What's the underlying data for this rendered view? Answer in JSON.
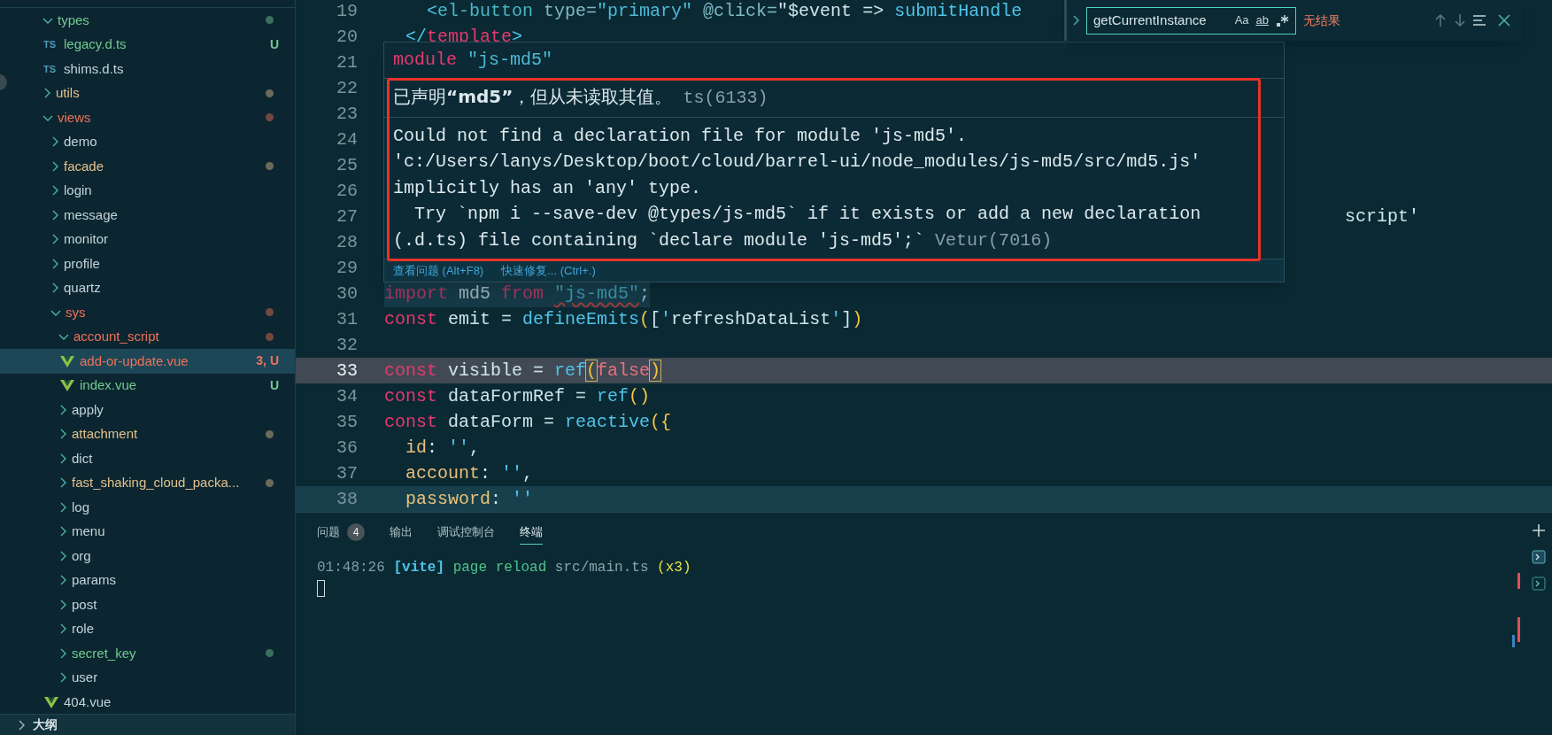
{
  "sidebar": {
    "tree": [
      {
        "label": "types",
        "kind": "folder",
        "expanded": true,
        "color": "#73c991",
        "dot": true,
        "selected": false,
        "children": [
          {
            "label": "legacy.d.ts",
            "kind": "ts_file",
            "icon_text": "TS",
            "color": "#73c991",
            "badge": "U",
            "selected": false
          },
          {
            "label": "shims.d.ts",
            "kind": "ts_file",
            "icon_text": "TS",
            "color": "#c3d3d8",
            "selected": false
          }
        ]
      },
      {
        "label": "utils",
        "kind": "folder",
        "expanded": false,
        "color": "#e2c08d",
        "dot": true,
        "selected": false
      },
      {
        "label": "views",
        "kind": "folder",
        "expanded": true,
        "color": "#f0715a",
        "dot": true,
        "selected": false,
        "children": [
          {
            "label": "demo",
            "kind": "folder",
            "expanded": false,
            "color": "#c3d3d8",
            "dot": false,
            "selected": false
          },
          {
            "label": "facade",
            "kind": "folder",
            "expanded": false,
            "color": "#e2c08d",
            "dot": true,
            "selected": false
          },
          {
            "label": "login",
            "kind": "folder",
            "expanded": false,
            "color": "#c3d3d8",
            "dot": false,
            "selected": false
          },
          {
            "label": "message",
            "kind": "folder",
            "expanded": false,
            "color": "#c3d3d8",
            "dot": false,
            "selected": false
          },
          {
            "label": "monitor",
            "kind": "folder",
            "expanded": false,
            "color": "#c3d3d8",
            "dot": false,
            "selected": false
          },
          {
            "label": "profile",
            "kind": "folder",
            "expanded": false,
            "color": "#c3d3d8",
            "dot": false,
            "selected": false
          },
          {
            "label": "quartz",
            "kind": "folder",
            "expanded": false,
            "color": "#c3d3d8",
            "dot": false,
            "selected": false
          },
          {
            "label": "sys",
            "kind": "folder",
            "expanded": true,
            "color": "#f0715a",
            "dot": true,
            "selected": false,
            "children": [
              {
                "label": "account_script",
                "kind": "folder",
                "expanded": true,
                "color": "#f0715a",
                "dot": true,
                "selected": false,
                "children": [
                  {
                    "label": "add-or-update.vue",
                    "kind": "vue_file",
                    "color": "#f0715a",
                    "badge": "3, U",
                    "selected": true
                  },
                  {
                    "label": "index.vue",
                    "kind": "vue_file",
                    "color": "#73c991",
                    "badge": "U",
                    "selected": false
                  }
                ]
              },
              {
                "label": "apply",
                "kind": "folder",
                "expanded": false,
                "color": "#c3d3d8",
                "dot": false,
                "selected": false
              },
              {
                "label": "attachment",
                "kind": "folder",
                "expanded": false,
                "color": "#e2c08d",
                "dot": true,
                "selected": false
              },
              {
                "label": "dict",
                "kind": "folder",
                "expanded": false,
                "color": "#c3d3d8",
                "dot": false,
                "selected": false
              },
              {
                "label": "fast_shaking_cloud_packa...",
                "kind": "folder",
                "expanded": false,
                "color": "#e2c08d",
                "dot": true,
                "selected": false
              },
              {
                "label": "log",
                "kind": "folder",
                "expanded": false,
                "color": "#c3d3d8",
                "dot": false,
                "selected": false
              },
              {
                "label": "menu",
                "kind": "folder",
                "expanded": false,
                "color": "#c3d3d8",
                "dot": false,
                "selected": false
              },
              {
                "label": "org",
                "kind": "folder",
                "expanded": false,
                "color": "#c3d3d8",
                "dot": false,
                "selected": false
              },
              {
                "label": "params",
                "kind": "folder",
                "expanded": false,
                "color": "#c3d3d8",
                "dot": false,
                "selected": false
              },
              {
                "label": "post",
                "kind": "folder",
                "expanded": false,
                "color": "#c3d3d8",
                "dot": false,
                "selected": false
              },
              {
                "label": "role",
                "kind": "folder",
                "expanded": false,
                "color": "#c3d3d8",
                "dot": false,
                "selected": false
              },
              {
                "label": "secret_key",
                "kind": "folder",
                "expanded": false,
                "color": "#73c991",
                "dot": true,
                "selected": false
              },
              {
                "label": "user",
                "kind": "folder",
                "expanded": false,
                "color": "#c3d3d8",
                "dot": false,
                "selected": false
              }
            ]
          },
          {
            "label": "404.vue",
            "kind": "vue_file",
            "color": "#c3d3d8",
            "selected": false
          }
        ]
      }
    ],
    "outline_title": "大纲"
  },
  "editor": {
    "lines": [
      {
        "number": "19",
        "tokens": [
          {
            "text": "    <",
            "kind": "quote"
          },
          {
            "text": "el-button",
            "kind": "tag"
          },
          {
            "text": " type=",
            "kind": "attr"
          },
          {
            "text": "\"primary\"",
            "kind": "str"
          },
          {
            "text": " @click=",
            "kind": "attr"
          },
          {
            "text": "\"$event =>",
            "kind": "id"
          },
          {
            "text": " submitHandle",
            "kind": "fn"
          }
        ]
      },
      {
        "number": "20",
        "tokens": [
          {
            "text": "  </",
            "kind": "quote"
          },
          {
            "text": "template",
            "kind": "kw"
          },
          {
            "text": ">",
            "kind": "quote"
          }
        ]
      },
      {
        "number": "21"
      },
      {
        "number": "22"
      },
      {
        "number": "23"
      },
      {
        "number": "24"
      },
      {
        "number": "25"
      },
      {
        "number": "26"
      },
      {
        "number": "27",
        "covered": true,
        "tokens": [
          {
            "text": "script'",
            "kind": "id"
          }
        ]
      },
      {
        "number": "28"
      },
      {
        "number": "29"
      },
      {
        "number": "30",
        "selected": true,
        "faded": true,
        "tokens": [
          {
            "text": "import",
            "kind": "kw"
          },
          {
            "text": " md5 ",
            "kind": "id"
          },
          {
            "text": "from ",
            "kind": "kw"
          },
          {
            "text": "\"js-md5\"",
            "kind": "str",
            "error": true
          },
          {
            "text": ";",
            "kind": "id"
          }
        ]
      },
      {
        "number": "31",
        "tokens": [
          {
            "text": "const",
            "kind": "kw"
          },
          {
            "text": " emit = ",
            "kind": "id"
          },
          {
            "text": "defineEmits",
            "kind": "fn"
          },
          {
            "text": "(",
            "kind": "bracket"
          },
          {
            "text": "[",
            "kind": "id"
          },
          {
            "text": "'",
            "kind": "quote"
          },
          {
            "text": "refreshDataList",
            "kind": "id"
          },
          {
            "text": "'",
            "kind": "quote"
          },
          {
            "text": "]",
            "kind": "id"
          },
          {
            "text": ")",
            "kind": "bracket"
          }
        ]
      },
      {
        "number": "32"
      },
      {
        "number": "33",
        "current": true,
        "tokens": [
          {
            "text": "const",
            "kind": "kw"
          },
          {
            "text": " visible = ",
            "kind": "id"
          },
          {
            "text": "ref",
            "kind": "fn"
          },
          {
            "text": "(",
            "kind": "bracket",
            "matched": true
          },
          {
            "text": "false",
            "kind": "bool"
          },
          {
            "text": ")",
            "kind": "bracket",
            "matched": true
          }
        ]
      },
      {
        "number": "34",
        "tokens": [
          {
            "text": "const",
            "kind": "kw"
          },
          {
            "text": " dataFormRef = ",
            "kind": "id"
          },
          {
            "text": "ref",
            "kind": "fn"
          },
          {
            "text": "()",
            "kind": "bracket"
          }
        ]
      },
      {
        "number": "35",
        "tokens": [
          {
            "text": "const",
            "kind": "kw"
          },
          {
            "text": " dataForm = ",
            "kind": "id"
          },
          {
            "text": "reactive",
            "kind": "fn"
          },
          {
            "text": "({",
            "kind": "bracket"
          }
        ]
      },
      {
        "number": "36",
        "tokens": [
          {
            "text": "  id",
            "kind": "prop"
          },
          {
            "text": ": ",
            "kind": "id"
          },
          {
            "text": "''",
            "kind": "quote"
          },
          {
            "text": ",",
            "kind": "id"
          }
        ]
      },
      {
        "number": "37",
        "tokens": [
          {
            "text": "  account",
            "kind": "prop"
          },
          {
            "text": ": ",
            "kind": "id"
          },
          {
            "text": "''",
            "kind": "quote"
          },
          {
            "text": ",",
            "kind": "id"
          }
        ]
      },
      {
        "number": "38",
        "highlighted": true,
        "tokens": [
          {
            "text": "  password",
            "kind": "prop"
          },
          {
            "text": ": ",
            "kind": "id"
          },
          {
            "text": "''",
            "kind": "quote"
          }
        ]
      }
    ],
    "hover": {
      "title": [
        {
          "text": "module ",
          "kind": "kw"
        },
        {
          "text": "\"js-md5\"",
          "kind": "str"
        }
      ],
      "messages": [
        {
          "lines": [
            "已声明**“md5”**，但从未读取其值。"
          ],
          "source": "ts(6133)"
        },
        {
          "lines": [
            "Could not find a declaration file for module 'js-md5'.",
            "'c:/Users/lanys/Desktop/boot/cloud/barrel-ui/node_modules/js-md5/src/md5.js'",
            "implicitly has an 'any' type.",
            "  Try `npm i --save-dev @types/js-md5` if it exists or add a new declaration",
            "(.d.ts) file containing `declare module 'js-md5';`"
          ],
          "source": "Vetur(7016)"
        }
      ],
      "actions": [
        "查看问题 (Alt+F8)",
        "快速修复... (Ctrl+.)"
      ]
    },
    "find": {
      "value": "getCurrentInstance",
      "options": [
        "Aa",
        "ab"
      ],
      "result": "无结果"
    }
  },
  "panel": {
    "tabs": [
      {
        "label": "问题",
        "count": "4",
        "selected": false
      },
      {
        "label": "输出",
        "selected": false
      },
      {
        "label": "调试控制台",
        "selected": false
      },
      {
        "label": "终端",
        "selected": true
      }
    ],
    "terminal": [
      {
        "text": "01:48:26 ",
        "kind": "time"
      },
      {
        "text": "[vite]",
        "kind": "tag"
      },
      {
        "text": " page reload ",
        "kind": "msg"
      },
      {
        "text": "src/main.ts",
        "kind": "path"
      },
      {
        "text": " (x3)",
        "kind": "count"
      }
    ]
  }
}
